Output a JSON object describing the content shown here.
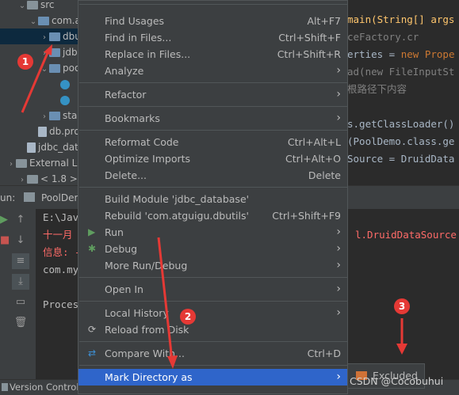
{
  "project_tree": {
    "rows": [
      {
        "label": "src",
        "indent": 1,
        "expanded": true,
        "icon": "folder-icon"
      },
      {
        "label": "com.at",
        "indent": 2,
        "expanded": true,
        "icon": "package-icon"
      },
      {
        "label": "dbu",
        "indent": 3,
        "expanded": false,
        "icon": "package-icon",
        "selected": true
      },
      {
        "label": "jdb",
        "indent": 3,
        "expanded": false,
        "icon": "package-icon"
      },
      {
        "label": "poo",
        "indent": 3,
        "expanded": true,
        "icon": "package-icon"
      },
      {
        "label": "",
        "indent": 4,
        "icon": "class-icon"
      },
      {
        "label": "",
        "indent": 4,
        "icon": "class-icon"
      },
      {
        "label": "sta",
        "indent": 3,
        "expanded": false,
        "icon": "package-icon"
      },
      {
        "label": "db.pro",
        "indent": 2,
        "icon": "properties-file-icon"
      },
      {
        "label": "jdbc_data",
        "indent": 1,
        "icon": "module-file-icon"
      },
      {
        "label": "External Libr",
        "indent": 0,
        "expanded": false,
        "icon": "library-icon"
      },
      {
        "label": "< 1.8 >",
        "indent": 1,
        "expanded": false,
        "icon": "jdk-icon"
      }
    ]
  },
  "editor": {
    "lines": [
      {
        "text": "main(String[] args",
        "color": "#ffc66d",
        "kw": ""
      },
      {
        "text": "ceFactory.cr",
        "color": "#808080",
        "kw": ""
      },
      {
        "text": "erties = ",
        "color": "#a9b7c6",
        "kw": "new Prope"
      },
      {
        "text": "ad(new FileInputSt",
        "color": "#808080",
        "kw": ""
      },
      {
        "text": "根路径下内容",
        "color": "#808080",
        "kw": ""
      },
      {
        "text": "",
        "color": "#a9b7c6",
        "kw": ""
      },
      {
        "text": "s.getClassLoader()",
        "color": "#a9b7c6",
        "kw": ""
      },
      {
        "text": "(PoolDemo.class.ge",
        "color": "#a9b7c6",
        "kw": ""
      },
      {
        "text": "Source = DruidData",
        "color": "#a9b7c6",
        "kw": ""
      }
    ]
  },
  "run_window": {
    "run_label": "un:",
    "tab_label": "PoolDer",
    "console": [
      {
        "text": "E:\\Jav",
        "color": "#bbbbbb"
      },
      {
        "text": "十一月",
        "color": "#ff6b68"
      },
      {
        "text": "信息: -",
        "color": "#ff6b68"
      },
      {
        "text": "com.my",
        "color": "#bbbbbb"
      },
      {
        "text": "",
        "color": "#bbbbbb"
      },
      {
        "text": "Proces",
        "color": "#bbbbbb"
      }
    ],
    "console_right": "l.DruidDataSource"
  },
  "status_bar": {
    "label": "Version Control"
  },
  "context_menu": {
    "items": [
      {
        "label": "Find Usages",
        "shortcut": "Alt+F7"
      },
      {
        "label": "Find in Files...",
        "shortcut": "Ctrl+Shift+F"
      },
      {
        "label": "Replace in Files...",
        "shortcut": "Ctrl+Shift+R"
      },
      {
        "label": "Analyze",
        "submenu": true
      },
      {
        "label": "Refactor",
        "submenu": true
      },
      {
        "label": "Bookmarks",
        "submenu": true
      },
      {
        "label": "Reformat Code",
        "shortcut": "Ctrl+Alt+L"
      },
      {
        "label": "Optimize Imports",
        "shortcut": "Ctrl+Alt+O"
      },
      {
        "label": "Delete...",
        "shortcut": "Delete"
      },
      {
        "label": "Build Module 'jdbc_database'",
        "shortcut": ""
      },
      {
        "label": "Rebuild 'com.atguigu.dbutils'",
        "shortcut": "Ctrl+Shift+F9"
      },
      {
        "label": "Run",
        "submenu": true,
        "icon": "run-icon"
      },
      {
        "label": "Debug",
        "submenu": true,
        "icon": "debug-icon"
      },
      {
        "label": "More Run/Debug",
        "submenu": true
      },
      {
        "label": "Open In",
        "submenu": true
      },
      {
        "label": "Local History",
        "submenu": true
      },
      {
        "label": "Reload from Disk",
        "icon": "reload-icon"
      },
      {
        "label": "Compare With...",
        "shortcut": "Ctrl+D",
        "icon": "compare-icon"
      },
      {
        "label": "Mark Directory as",
        "submenu": true,
        "highlighted": true
      }
    ]
  },
  "submenu": {
    "label": "Excluded"
  },
  "annotations": {
    "badge1": "1",
    "badge2": "2",
    "badge3": "3",
    "accent": "#e53935"
  },
  "watermark": "CSDN @Cocobuhui"
}
